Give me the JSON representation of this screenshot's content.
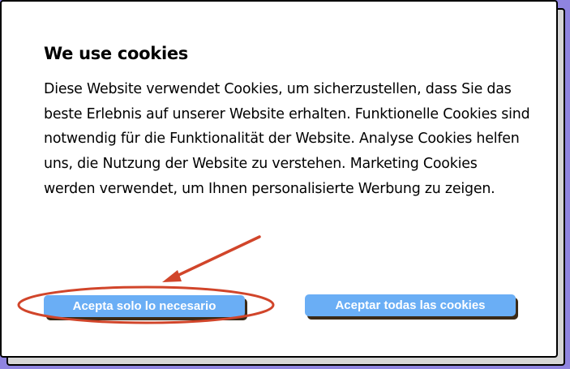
{
  "dialog": {
    "title": "We use cookies",
    "body": "Diese Website verwendet Cookies, um sicherzustellen, dass Sie das beste Erlebnis auf unserer Website erhalten. Funktionelle Cookies sind notwendig für die Funktionalität der Website. Analyse Cookies helfen uns, die Nutzung der Website zu verstehen. Marketing Cookies werden verwendet, um Ihnen personalisierte Werbung zu zeigen."
  },
  "buttons": {
    "necessary_label": "Acepta solo lo necesario",
    "accept_all_label": "Aceptar todas las cookies"
  },
  "annotation": {
    "type": "arrow-and-ellipse",
    "target": "necessary-button",
    "color": "#d1452a"
  },
  "colors": {
    "page_background": "#8f84e0",
    "button_background": "#6aaef5",
    "button_shadow": "#3b2a16"
  }
}
